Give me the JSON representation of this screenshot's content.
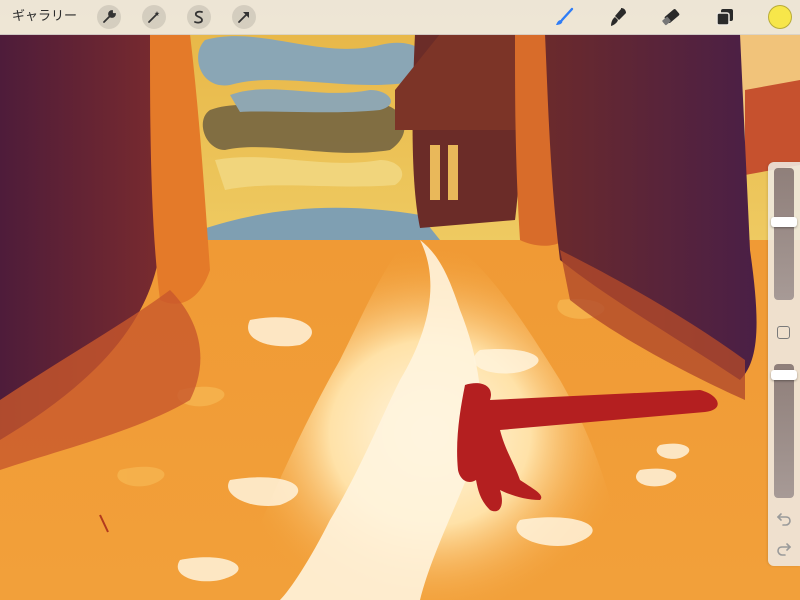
{
  "toolbar": {
    "gallery_label": "ギャラリー",
    "left_tools": [
      {
        "name": "actions",
        "icon": "wrench-icon"
      },
      {
        "name": "adjustments",
        "icon": "magic-wand-icon"
      },
      {
        "name": "selection",
        "icon": "selection-s-icon"
      },
      {
        "name": "transform",
        "icon": "arrow-cursor-icon"
      }
    ],
    "right_tools": [
      {
        "name": "brush",
        "icon": "brush-icon",
        "active": true
      },
      {
        "name": "smudge",
        "icon": "smudge-icon"
      },
      {
        "name": "eraser",
        "icon": "eraser-icon"
      },
      {
        "name": "layers",
        "icon": "layers-icon"
      }
    ],
    "current_color": "#f7e64a",
    "active_color": "#2f7df6"
  },
  "sidebar": {
    "brush_size_level": 0.6,
    "opacity_level": 0.95,
    "undo_icon": "undo-icon",
    "redo_icon": "redo-icon"
  },
  "artwork": {
    "description_icon": "painting-canvas",
    "palette": {
      "sky": "#e9bf4f",
      "cloud_blue": "#7e9bb0",
      "building_dark": "#6a2c2a",
      "wall_purple": "#5a2040",
      "road_light": "#fff1d6",
      "orange": "#ec8a28",
      "figure_red": "#b7201f"
    }
  }
}
